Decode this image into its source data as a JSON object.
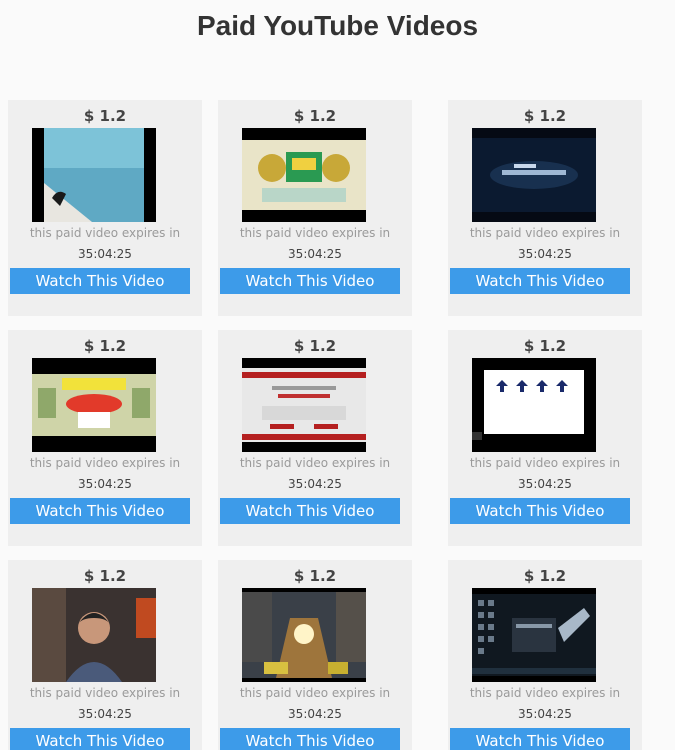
{
  "page": {
    "title": "Paid YouTube Videos"
  },
  "videos": [
    {
      "price": "$ 1.2",
      "expires_label": "this paid video expires in",
      "countdown": "35:04:25",
      "button_label": "Watch This Video",
      "thumbnail": "pool-icon"
    },
    {
      "price": "$ 1.2",
      "expires_label": "this paid video expires in",
      "countdown": "35:04:25",
      "button_label": "Watch This Video",
      "thumbnail": "banner-icon"
    },
    {
      "price": "$ 1.2",
      "expires_label": "this paid video expires in",
      "countdown": "35:04:25",
      "button_label": "Watch This Video",
      "thumbnail": "dark-title-icon"
    },
    {
      "price": "$ 1.2",
      "expires_label": "this paid video expires in",
      "countdown": "35:04:25",
      "button_label": "Watch This Video",
      "thumbnail": "collage-icon"
    },
    {
      "price": "$ 1.2",
      "expires_label": "this paid video expires in",
      "countdown": "35:04:25",
      "button_label": "Watch This Video",
      "thumbnail": "webpage-icon"
    },
    {
      "price": "$ 1.2",
      "expires_label": "this paid video expires in",
      "countdown": "35:04:25",
      "button_label": "Watch This Video",
      "thumbnail": "slide-icon"
    },
    {
      "price": "$ 1.2",
      "expires_label": "this paid video expires in",
      "countdown": "35:04:25",
      "button_label": "Watch This Video",
      "thumbnail": "person-icon"
    },
    {
      "price": "$ 1.2",
      "expires_label": "this paid video expires in",
      "countdown": "35:04:25",
      "button_label": "Watch This Video",
      "thumbnail": "street-icon"
    },
    {
      "price": "$ 1.2",
      "expires_label": "this paid video expires in",
      "countdown": "35:04:25",
      "button_label": "Watch This Video",
      "thumbnail": "desktop-icon"
    }
  ],
  "colors": {
    "button": "#3d9be9",
    "card": "#efefef",
    "title": "#333333"
  }
}
